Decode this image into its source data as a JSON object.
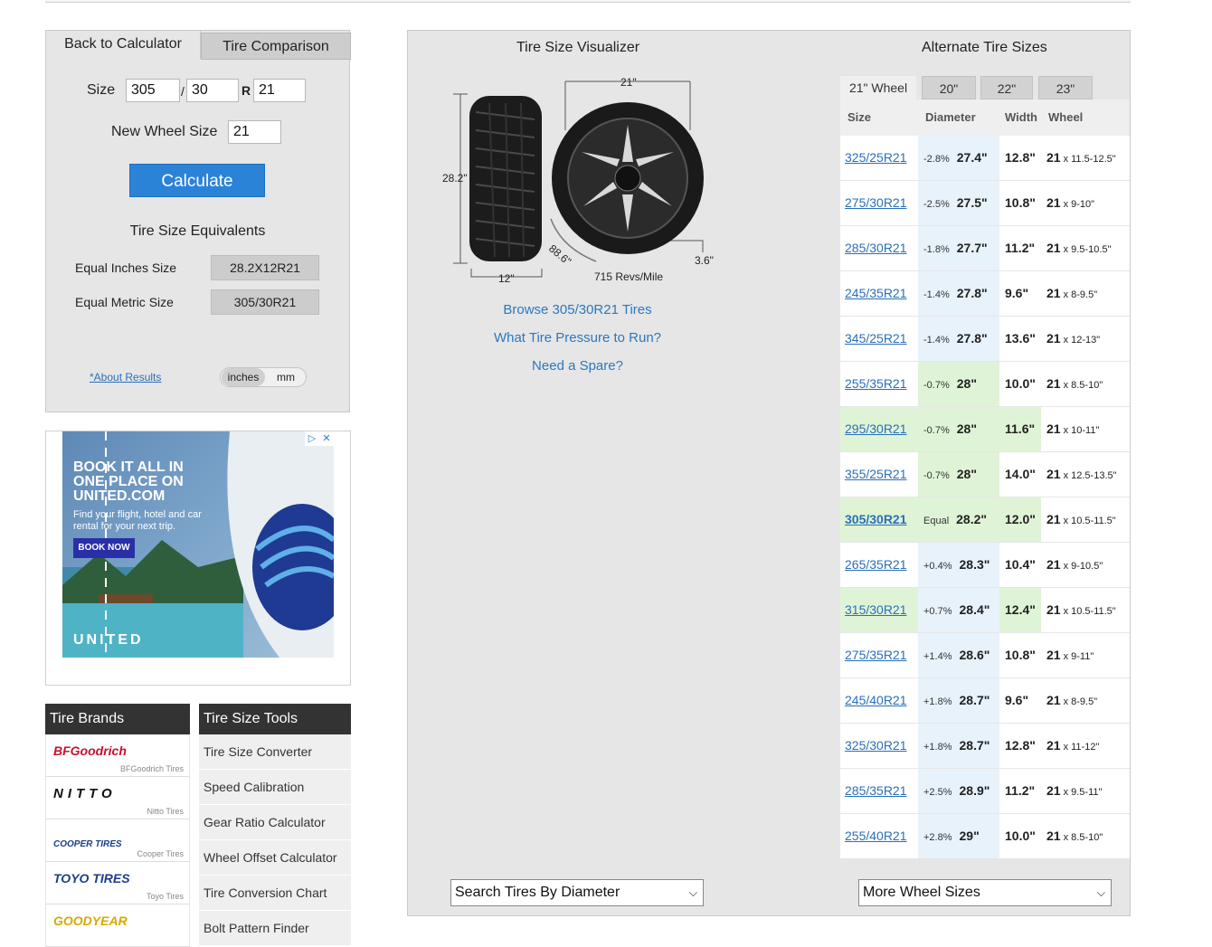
{
  "calculator": {
    "tab_back": "Back to Calculator",
    "tab_comparison": "Tire Comparison",
    "size_label": "Size",
    "width": "305",
    "slash": "/",
    "aspect": "30",
    "r": "R",
    "rim": "21",
    "new_wheel_label": "New Wheel Size",
    "new_wheel_value": "21",
    "calculate_label": "Calculate",
    "equivalents_title": "Tire Size Equivalents",
    "equal_inches_label": "Equal Inches Size",
    "equal_inches_value": "28.2X12R21",
    "equal_metric_label": "Equal Metric Size",
    "equal_metric_value": "305/30R21",
    "about_link": "*About Results",
    "unit_inches": "inches",
    "unit_mm": "mm"
  },
  "ad": {
    "headline_1": "BOOK IT ALL IN",
    "headline_2": "ONE PLACE ON",
    "headline_3": "UNITED.COM",
    "sub": "Find your flight, hotel and car rental for your next trip.",
    "button": "BOOK NOW",
    "brand": "UNITED",
    "adchoice": "▷",
    "close": "✕"
  },
  "brands": {
    "title": "Tire Brands",
    "items": [
      {
        "logo": "BFGoodrich",
        "name": "BFGoodrich Tires",
        "color": "#c8102e"
      },
      {
        "logo": "NITTO",
        "name": "Nitto Tires",
        "color": "#111111"
      },
      {
        "logo": "COOPER TIRES",
        "name": "Cooper Tires",
        "color": "#1b3e8a"
      },
      {
        "logo": "TOYO TIRES",
        "name": "Toyo Tires",
        "color": "#1b3e8a"
      },
      {
        "logo": "GOODYEAR",
        "name": "",
        "color": "#e0b400"
      }
    ]
  },
  "tools": {
    "title": "Tire Size Tools",
    "items": [
      "Tire Size Converter",
      "Speed Calibration",
      "Gear Ratio Calculator",
      "Wheel Offset Calculator",
      "Tire Conversion Chart",
      "Bolt Pattern Finder"
    ]
  },
  "visualizer": {
    "title": "Tire Size Visualizer",
    "height_label": "28.2\"",
    "width_label": "12\"",
    "rim_label": "21\"",
    "circ_label": "88.6\"",
    "sidewall_label": "3.6\"",
    "revs_label": "715 Revs/Mile",
    "browse_link": "Browse 305/30R21 Tires",
    "pressure_link": "What Tire Pressure to Run?",
    "spare_link": "Need a Spare?",
    "search_diameter": "Search Tires By Diameter",
    "more_wheels": "More Wheel Sizes"
  },
  "alternates": {
    "title": "Alternate Tire Sizes",
    "wheel_tabs": [
      "21\" Wheel",
      "20\"",
      "22\"",
      "23\""
    ],
    "headers": {
      "size": "Size",
      "diameter": "Diameter",
      "width": "Width",
      "wheel": "Wheel"
    },
    "rows": [
      {
        "size": "325/25R21",
        "pct": "-2.8%",
        "diam": "27.4\"",
        "width": "12.8\"",
        "wheel": "21",
        "range": "x 11.5-12.5\""
      },
      {
        "size": "275/30R21",
        "pct": "-2.5%",
        "diam": "27.5\"",
        "width": "10.8\"",
        "wheel": "21",
        "range": "x 9-10\""
      },
      {
        "size": "285/30R21",
        "pct": "-1.8%",
        "diam": "27.7\"",
        "width": "11.2\"",
        "wheel": "21",
        "range": "x 9.5-10.5\""
      },
      {
        "size": "245/35R21",
        "pct": "-1.4%",
        "diam": "27.8\"",
        "width": "9.6\"",
        "wheel": "21",
        "range": "x 8-9.5\""
      },
      {
        "size": "345/25R21",
        "pct": "-1.4%",
        "diam": "27.8\"",
        "width": "13.6\"",
        "wheel": "21",
        "range": "x 12-13\""
      },
      {
        "size": "255/35R21",
        "pct": "-0.7%",
        "diam": "28\"",
        "width": "10.0\"",
        "wheel": "21",
        "range": "x 8.5-10\""
      },
      {
        "size": "295/30R21",
        "pct": "-0.7%",
        "diam": "28\"",
        "width": "11.6\"",
        "wheel": "21",
        "range": "x 10-11\""
      },
      {
        "size": "355/25R21",
        "pct": "-0.7%",
        "diam": "28\"",
        "width": "14.0\"",
        "wheel": "21",
        "range": "x 12.5-13.5\""
      },
      {
        "size": "305/30R21",
        "pct": "Equal",
        "diam": "28.2\"",
        "width": "12.0\"",
        "wheel": "21",
        "range": "x 10.5-11.5\""
      },
      {
        "size": "265/35R21",
        "pct": "+0.4%",
        "diam": "28.3\"",
        "width": "10.4\"",
        "wheel": "21",
        "range": "x 9-10.5\""
      },
      {
        "size": "315/30R21",
        "pct": "+0.7%",
        "diam": "28.4\"",
        "width": "12.4\"",
        "wheel": "21",
        "range": "x 10.5-11.5\""
      },
      {
        "size": "275/35R21",
        "pct": "+1.4%",
        "diam": "28.6\"",
        "width": "10.8\"",
        "wheel": "21",
        "range": "x 9-11\""
      },
      {
        "size": "245/40R21",
        "pct": "+1.8%",
        "diam": "28.7\"",
        "width": "9.6\"",
        "wheel": "21",
        "range": "x 8-9.5\""
      },
      {
        "size": "325/30R21",
        "pct": "+1.8%",
        "diam": "28.7\"",
        "width": "12.8\"",
        "wheel": "21",
        "range": "x 11-12\""
      },
      {
        "size": "285/35R21",
        "pct": "+2.5%",
        "diam": "28.9\"",
        "width": "11.2\"",
        "wheel": "21",
        "range": "x 9.5-11\""
      },
      {
        "size": "255/40R21",
        "pct": "+2.8%",
        "diam": "29\"",
        "width": "10.0\"",
        "wheel": "21",
        "range": "x 8.5-10\""
      }
    ]
  },
  "colors": {
    "accent": "#2b83d8",
    "link": "#2a6fb8",
    "highlight": "#dff4d6",
    "diameter_bg": "#e7f2fb"
  }
}
